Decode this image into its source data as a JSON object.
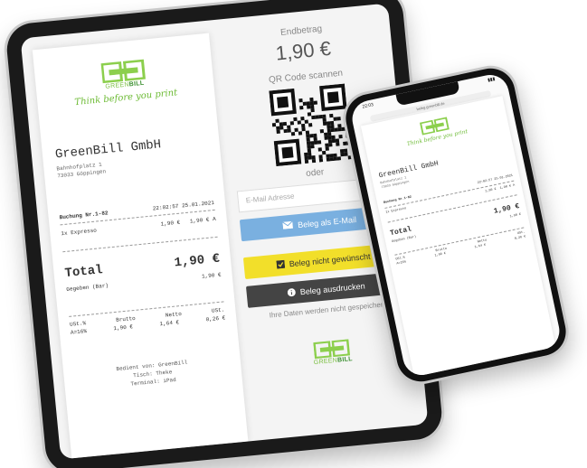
{
  "brand": {
    "logo_text_green": "GREEN",
    "logo_text_bold": "BILL",
    "slogan": "Think before you print"
  },
  "receipt": {
    "company": "GreenBill GmbH",
    "address_line1": "Bahnhofplatz 1",
    "address_line2": "73033 Göppingen",
    "booking_label": "Buchung Nr.1-82",
    "timestamp": "22:02:57 25.01.2021",
    "item_name": "1x Expresso",
    "item_price": "1,90 €",
    "item_total": "1,90 €",
    "item_tax_code": "A",
    "total_label": "Total",
    "total_amount": "1,90 €",
    "paid_label": "Gegeben (Bar)",
    "paid_amount": "1,90 €",
    "vat_headers": [
      "USt.%",
      "Brutto",
      "Netto",
      "USt."
    ],
    "vat_row": [
      "A=16%",
      "1,90 €",
      "1,64 €",
      "0,26 €"
    ],
    "served_by": "Bedient von: GreenBill",
    "table": "Tisch: Theke",
    "terminal": "Terminal: iPad"
  },
  "payment": {
    "endbetrag_label": "Endbetrag",
    "amount": "1,90 €",
    "qr_label": "QR Code scannen",
    "or_label": "oder",
    "email_placeholder": "E-Mail Adresse",
    "email_button": "Beleg als E-Mail",
    "no_receipt_button": "Beleg nicht gewünscht",
    "print_button": "Beleg ausdrucken",
    "privacy_note": "Ihre Daten werden nicht gespeichert."
  },
  "phone": {
    "time": "22:03",
    "url": "beleg.greenbill.de",
    "company": "GreenBill GmbH",
    "address_line1": "Bahnhofplatz 1",
    "address_line2": "73033 Göppingen",
    "booking_label": "Buchung Nr.1-82",
    "timestamp": "22:02:57 25.01.2021",
    "item_name": "1x Expresso",
    "item_price": "1,90 €",
    "item_total": "1,90 € A",
    "total_label": "Total",
    "total_amount": "1,90 €",
    "paid_label": "Gegeben (Bar)",
    "paid_amount": "1,90 €",
    "vat_headers": [
      "USt.%",
      "Brutto",
      "Netto",
      "USt."
    ],
    "vat_row": [
      "A=16%",
      "1,90 €",
      "1,64 €",
      "0,26 €"
    ]
  },
  "colors": {
    "brand_green": "#7cc043",
    "dark_green": "#3a8f2f",
    "email_button": "#7ab0e0",
    "no_receipt_button": "#f2df2a",
    "print_button": "#444444"
  }
}
